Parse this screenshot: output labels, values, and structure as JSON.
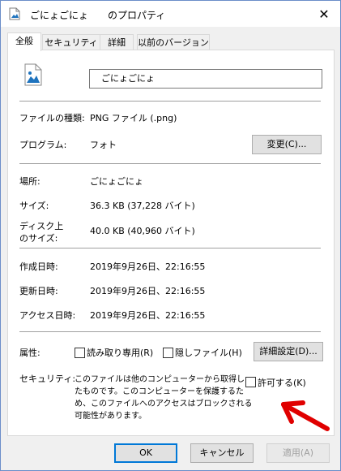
{
  "window": {
    "title": "ごにょごにょ　　のプロパティ"
  },
  "tabs": [
    {
      "label": "全般"
    },
    {
      "label": "セキュリティ"
    },
    {
      "label": "詳細"
    },
    {
      "label": "以前のバージョン"
    }
  ],
  "general": {
    "file_name": "ごにょごにょ",
    "file_type_label": "ファイルの種類:",
    "file_type_value": "PNG ファイル (.png)",
    "program_label": "プログラム:",
    "program_value": "フォト",
    "change_button": "変更(C)...",
    "location_label": "場所:",
    "location_value": "ごにょごにょ",
    "size_label": "サイズ:",
    "size_value": "36.3 KB (37,228 バイト)",
    "disk_size_label_line1": "ディスク上",
    "disk_size_label_line2": "のサイズ:",
    "disk_size_value": "40.0 KB (40,960 バイト)",
    "created_label": "作成日時:",
    "created_value": "2019年9月26日、22:16:55",
    "modified_label": "更新日時:",
    "modified_value": "2019年9月26日、22:16:55",
    "accessed_label": "アクセス日時:",
    "accessed_value": "2019年9月26日、22:16:55",
    "attributes_label": "属性:",
    "readonly_label": "読み取り専用(R)",
    "readonly_checked": false,
    "hidden_label": "隠しファイル(H)",
    "hidden_checked": false,
    "advanced_button": "詳細設定(D)...",
    "security_label": "セキュリティ:",
    "security_text_1": "このファイルは他のコンピューターから取得し",
    "security_text_2": "たものです。このコンピューターを保護するた",
    "security_text_3": "め、このファイルへのアクセスはブロックされる",
    "security_text_4": "可能性があります。",
    "unblock_label": "許可する(K)",
    "unblock_checked": false
  },
  "footer": {
    "ok_button": "OK",
    "cancel_button": "キャンセル",
    "apply_button": "適用(A)"
  },
  "colors": {
    "window_border": "#6b8ec9",
    "arrow": "#e00000",
    "ok_border": "#0078d7",
    "disabled_text": "#a0a0a0"
  },
  "icons": {
    "title_icon": "image-file-icon",
    "large_icon": "image-file-icon",
    "close": "close-icon",
    "annotation": "red-arrow-annotation"
  }
}
